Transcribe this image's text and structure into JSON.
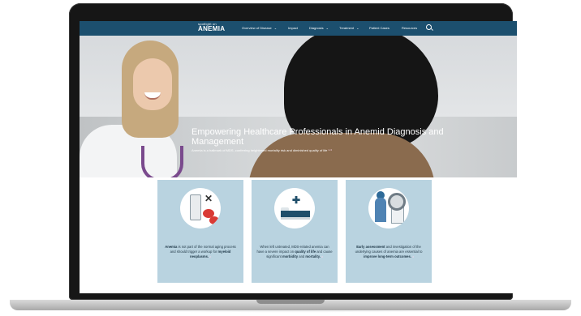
{
  "nav": {
    "logo_small": "spotlight on",
    "logo_big": "ANEMIA",
    "items": [
      {
        "label": "Overview of Disease",
        "dropdown": true
      },
      {
        "label": "Impact",
        "dropdown": false
      },
      {
        "label": "Diagnosis",
        "dropdown": true
      },
      {
        "label": "Treatment",
        "dropdown": true
      },
      {
        "label": "Patient Cases",
        "dropdown": false
      },
      {
        "label": "Resources",
        "dropdown": false
      }
    ],
    "search_icon": "search-icon"
  },
  "hero": {
    "title": "Empowering Healthcare Professionals in Anemid Diagnosis and Management",
    "subtitle": "Anemia is a hallmark of MDS, conferring heightened mortality risk and diminished quality of life",
    "subtitle_ref": "1-3"
  },
  "cards": [
    {
      "lead": "Anemia",
      "text": " is not part of the normal aging process and should trigger a workup for ",
      "bold": "myeloid neoplasms.",
      "ref": "2"
    },
    {
      "lead": "",
      "text": "When left untreated, MDS-related anemia can have a severe impact on ",
      "bold": "quality of life",
      "tail": " and cause significant ",
      "bold2": "morbidity",
      "tail2": " and ",
      "bold3": "mortality.",
      "ref": "3"
    },
    {
      "lead": "Early assessment",
      "text": " and investigation of the underlying causes of anemia are essential to ",
      "bold": "improve long-term outcomes.",
      "ref": "4"
    }
  ],
  "colors": {
    "nav_bg": "#1c4f6e",
    "card_bg": "#b9d3e0",
    "accent_red": "#d93a35"
  }
}
